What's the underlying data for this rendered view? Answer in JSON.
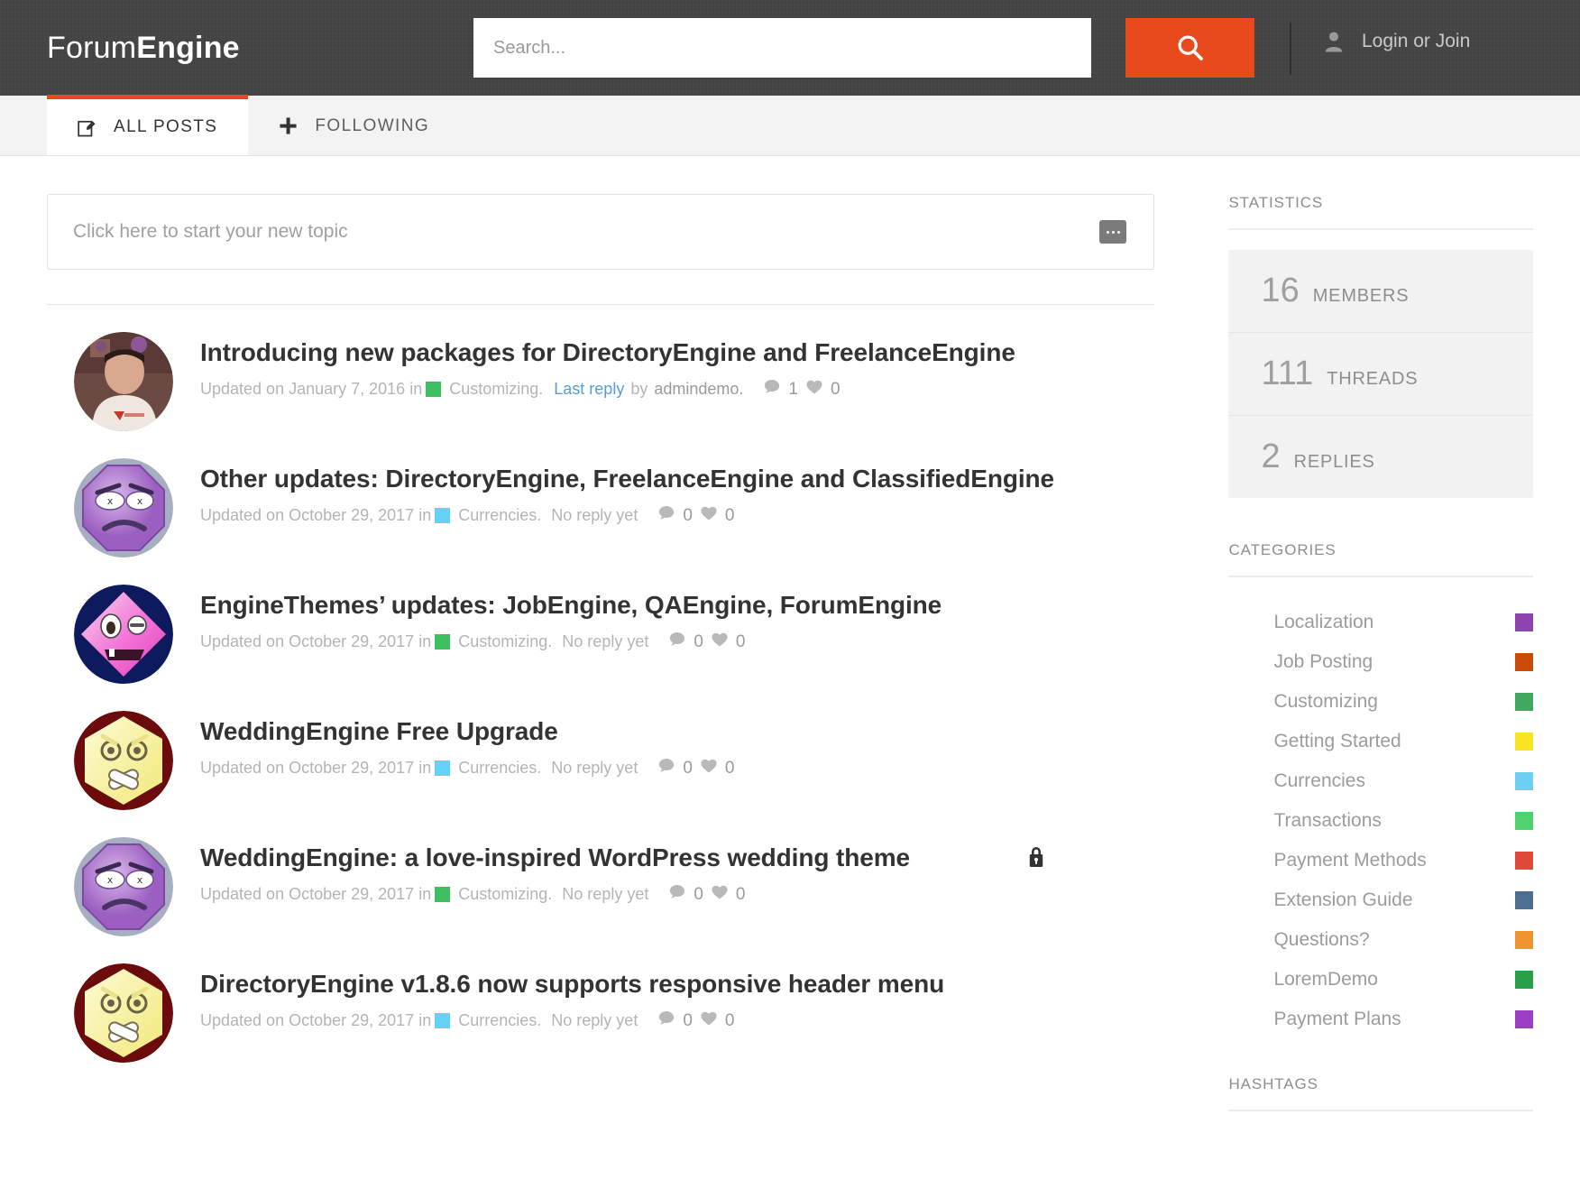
{
  "header": {
    "logo_thin": "Forum",
    "logo_bold": "Engine",
    "search_placeholder": "Search...",
    "search_value": "",
    "search_icon": "search-icon",
    "account_icon": "person-icon",
    "account_label": "Login or Join",
    "accent_color": "#e8491d",
    "bar_color": "#444444"
  },
  "tabs": [
    {
      "label": "ALL POSTS",
      "icon": "compose-icon",
      "active": true
    },
    {
      "label": "FOLLOWING",
      "icon": "plus-icon",
      "active": false
    }
  ],
  "new_topic": {
    "placeholder": "Click here to start your new topic",
    "more_icon": "ellipsis-icon"
  },
  "posts": [
    {
      "title": "Introducing new packages for DirectoryEngine and FreelanceEngine",
      "updated_prefix": "Updated on",
      "date": "January 7, 2016",
      "in_word": "in",
      "category": "Customizing",
      "category_color": "#3fbf61",
      "reply_status": "Last reply",
      "reply_status_link": true,
      "by_word": "by",
      "author": "admindemo.",
      "comments": "1",
      "likes": "0",
      "locked": false,
      "avatar": "photo-avatar"
    },
    {
      "title": "Other updates: DirectoryEngine, FreelanceEngine and ClassifiedEngine",
      "updated_prefix": "Updated on",
      "date": "October 29, 2017",
      "in_word": "in",
      "category": "Currencies",
      "category_color": "#63d3f5",
      "reply_status": "No reply yet",
      "reply_status_link": false,
      "by_word": "",
      "author": "",
      "comments": "0",
      "likes": "0",
      "locked": false,
      "avatar": "purple-octagon-avatar"
    },
    {
      "title": "EngineThemes’ updates: JobEngine, QAEngine, ForumEngine",
      "updated_prefix": "Updated on",
      "date": "October 29, 2017",
      "in_word": "in",
      "category": "Customizing",
      "category_color": "#3fbf61",
      "reply_status": "No reply yet",
      "reply_status_link": false,
      "by_word": "",
      "author": "",
      "comments": "0",
      "likes": "0",
      "locked": false,
      "avatar": "pink-diamond-avatar"
    },
    {
      "title": "WeddingEngine Free Upgrade",
      "updated_prefix": "Updated on",
      "date": "October 29, 2017",
      "in_word": "in",
      "category": "Currencies",
      "category_color": "#63d3f5",
      "reply_status": "No reply yet",
      "reply_status_link": false,
      "by_word": "",
      "author": "",
      "comments": "0",
      "likes": "0",
      "locked": false,
      "avatar": "yellow-hexagon-avatar"
    },
    {
      "title": "WeddingEngine: a love-inspired WordPress wedding theme",
      "updated_prefix": "Updated on",
      "date": "October 29, 2017",
      "in_word": "in",
      "category": "Customizing",
      "category_color": "#3fbf61",
      "reply_status": "No reply yet",
      "reply_status_link": false,
      "by_word": "",
      "author": "",
      "comments": "0",
      "likes": "0",
      "locked": true,
      "lock_icon": "lock-icon",
      "avatar": "purple-octagon-avatar"
    },
    {
      "title": "DirectoryEngine v1.8.6 now supports responsive header menu",
      "updated_prefix": "Updated on",
      "date": "October 29, 2017",
      "in_word": "in",
      "category": "Currencies",
      "category_color": "#63d3f5",
      "reply_status": "No reply yet",
      "reply_status_link": false,
      "by_word": "",
      "author": "",
      "comments": "0",
      "likes": "0",
      "locked": false,
      "avatar": "yellow-hexagon-avatar"
    }
  ],
  "sidebar": {
    "statistics_heading": "STATISTICS",
    "stats": [
      {
        "value": "16",
        "label": "MEMBERS"
      },
      {
        "value": "111",
        "label": "THREADS"
      },
      {
        "value": "2",
        "label": "REPLIES"
      }
    ],
    "categories_heading": "CATEGORIES",
    "categories": [
      {
        "name": "Localization",
        "color": "#8e44ad"
      },
      {
        "name": "Job Posting",
        "color": "#c94b06"
      },
      {
        "name": "Customizing",
        "color": "#3fa95e"
      },
      {
        "name": "Getting Started",
        "color": "#f7e422"
      },
      {
        "name": "Currencies",
        "color": "#6dd0f0"
      },
      {
        "name": "Transactions",
        "color": "#4fd16e"
      },
      {
        "name": "Payment Methods",
        "color": "#e0483a"
      },
      {
        "name": "Extension Guide",
        "color": "#4f6e8f"
      },
      {
        "name": "Questions?",
        "color": "#ef942e"
      },
      {
        "name": "LoremDemo",
        "color": "#27a048"
      },
      {
        "name": "Payment Plans",
        "color": "#9b3ec4"
      }
    ],
    "hashtags_heading": "HASHTAGS"
  }
}
